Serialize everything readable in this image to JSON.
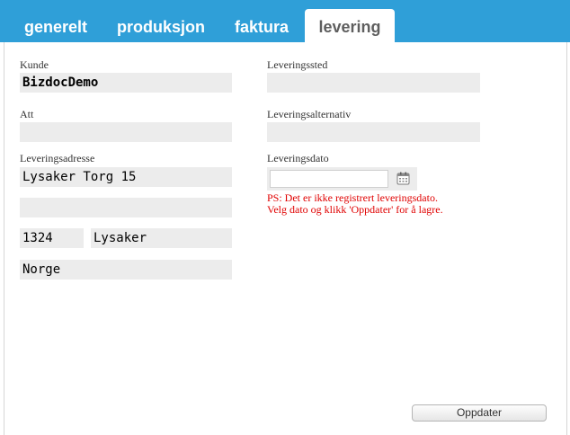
{
  "tabs": [
    {
      "label": "generelt",
      "active": false
    },
    {
      "label": "produksjon",
      "active": false
    },
    {
      "label": "faktura",
      "active": false
    },
    {
      "label": "levering",
      "active": true
    }
  ],
  "left": {
    "kunde_label": "Kunde",
    "kunde_value": "BizdocDemo",
    "att_label": "Att",
    "att_value": "",
    "adresse_label": "Leveringsadresse",
    "adresse_line1": "Lysaker Torg 15",
    "adresse_line2": "",
    "postnr": "1324",
    "poststed": "Lysaker",
    "land": "Norge"
  },
  "right": {
    "sted_label": "Leveringssted",
    "sted_value": "",
    "alternativ_label": "Leveringsalternativ",
    "alternativ_value": "",
    "dato_label": "Leveringsdato",
    "dato_value": "",
    "warning_line1": "PS: Det er ikke registrert leveringsdato.",
    "warning_line2": "Velg dato og klikk 'Oppdater' for å lagre."
  },
  "actions": {
    "update_label": "Oppdater"
  },
  "icons": {
    "date_picker": "calendar-icon"
  },
  "colors": {
    "tabbar": "#2f9fd8",
    "field_bg": "#ececec",
    "warning": "#e00000"
  }
}
